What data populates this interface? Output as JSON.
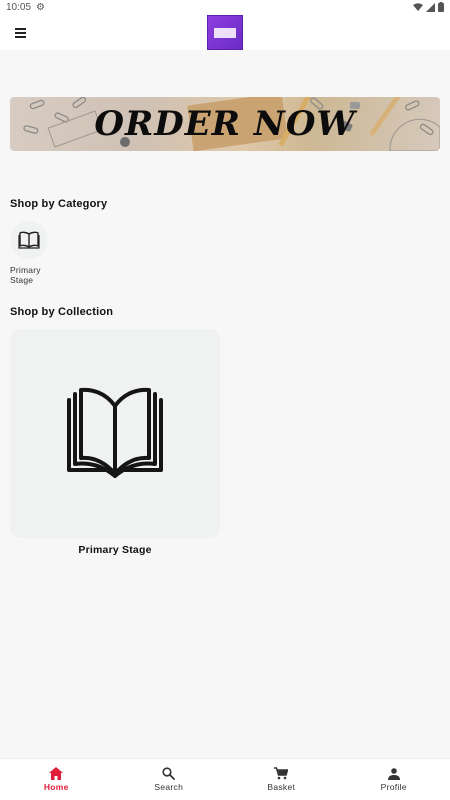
{
  "status_bar": {
    "time": "10:05",
    "icons": [
      "settings-gear-icon",
      "wifi-icon",
      "signal-icon",
      "battery-icon"
    ]
  },
  "app_bar": {
    "menu_icon": "hamburger-menu-icon",
    "logo_icon": "brand-logo"
  },
  "banner": {
    "text": "ORDER NOW"
  },
  "categories": {
    "title": "Shop by Category",
    "items": [
      {
        "label": "Primary Stage",
        "icon": "open-book-icon"
      }
    ]
  },
  "collections": {
    "title": "Shop by Collection",
    "items": [
      {
        "label": "Primary Stage",
        "icon": "open-book-icon"
      }
    ]
  },
  "bottom_nav": {
    "active": "Home",
    "active_color": "#e01e3c",
    "items": [
      {
        "label": "Home",
        "icon": "home-icon"
      },
      {
        "label": "Search",
        "icon": "search-icon"
      },
      {
        "label": "Basket",
        "icon": "cart-icon"
      },
      {
        "label": "Profile",
        "icon": "person-icon"
      }
    ]
  }
}
